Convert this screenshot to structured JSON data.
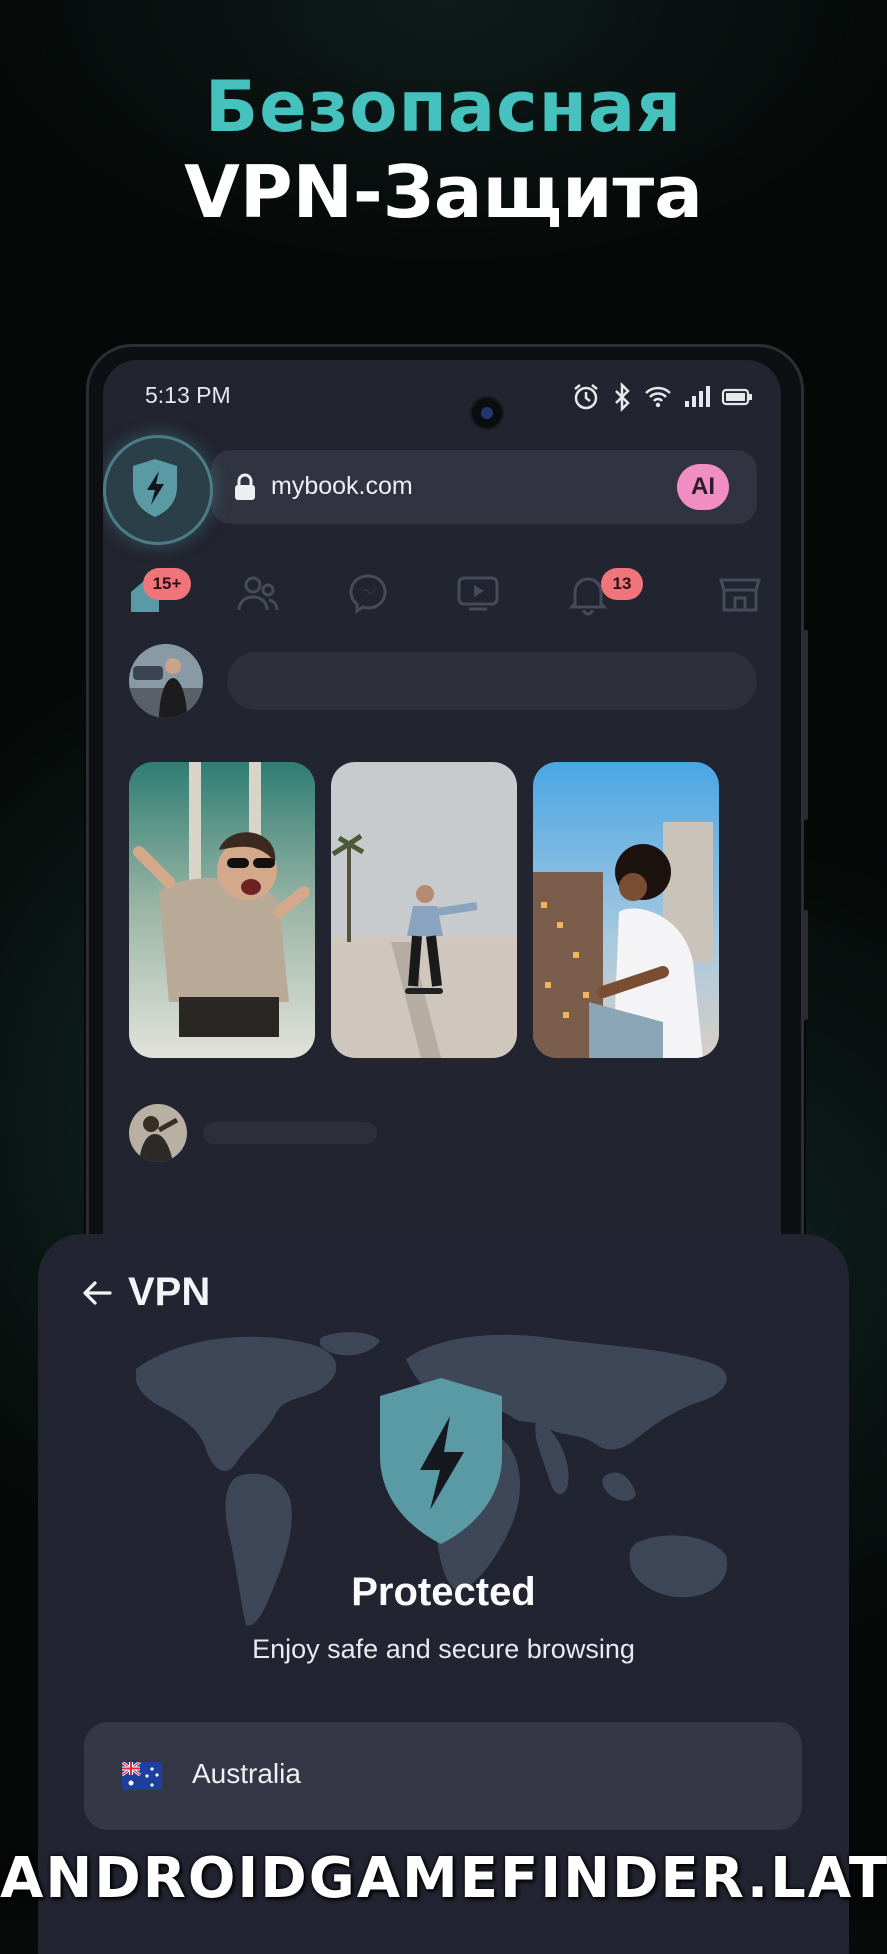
{
  "promo": {
    "headline_line1": "Безопасная",
    "headline_line2": "VPN-Защита"
  },
  "status_bar": {
    "time": "5:13 PM",
    "icons": [
      "alarm-icon",
      "bluetooth-icon",
      "wifi-icon",
      "signal-icon",
      "battery-icon"
    ]
  },
  "browser": {
    "url": "mybook.com",
    "ai_label": "AI",
    "vpn_button_icon": "shield-bolt-icon"
  },
  "nav": {
    "home_badge": "15+",
    "notifications_badge": "13",
    "items": [
      "home-icon",
      "friends-icon",
      "messenger-icon",
      "video-icon",
      "bell-icon",
      "marketplace-icon"
    ]
  },
  "vpn_panel": {
    "title": "VPN",
    "status": "Protected",
    "message": "Enjoy safe and secure browsing",
    "country": "Australia",
    "colors": {
      "accent": "#5a9aa4",
      "panel": "#222431"
    }
  },
  "watermark": "ANDROIDGAMEFINDER.LAT"
}
